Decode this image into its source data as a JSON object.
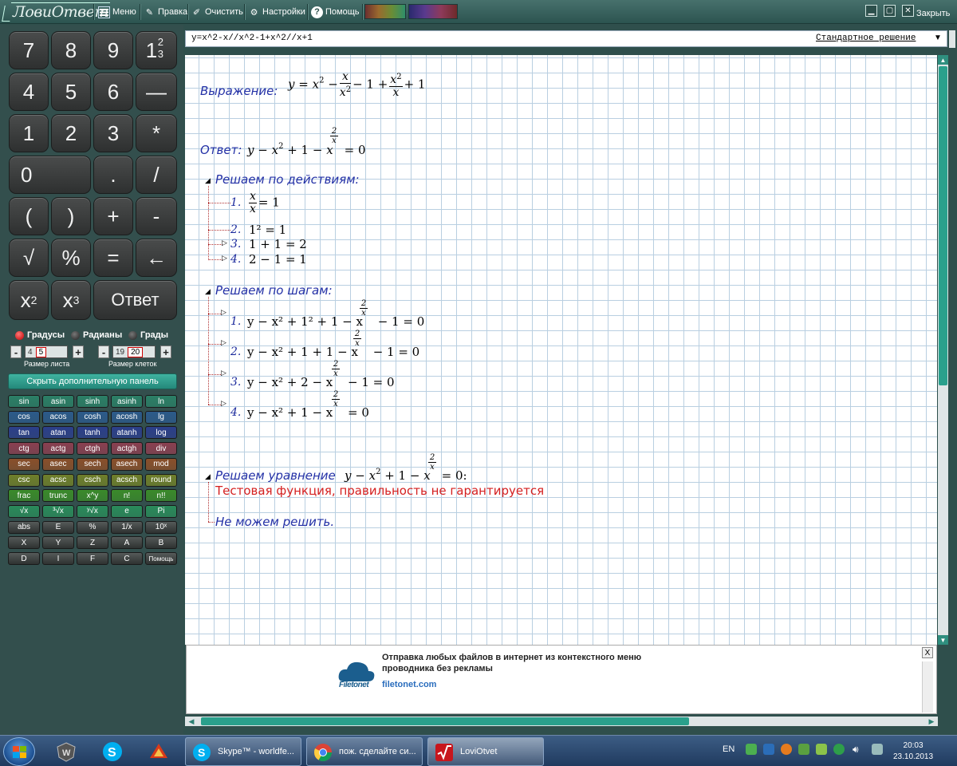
{
  "app": {
    "title": "ЛовиОтвет"
  },
  "toolbar": {
    "menu": "Меню",
    "edit": "Правка",
    "clear": "Очистить",
    "settings": "Настройки",
    "help": "Помощь",
    "close": "Закрыть"
  },
  "keypad": {
    "rows": [
      [
        "7",
        "8",
        "9",
        "1"
      ],
      [
        "4",
        "5",
        "6",
        "—"
      ],
      [
        "1",
        "2",
        "3",
        "*"
      ],
      [
        "0",
        ".",
        "/"
      ],
      [
        "(",
        ")",
        "+",
        "-"
      ],
      [
        "√",
        "%",
        "=",
        "←"
      ],
      [
        "x",
        "x",
        "Ответ"
      ]
    ],
    "frac_num": "2",
    "frac_den": "3",
    "sq": "2",
    "cube": "3"
  },
  "angle_units": {
    "degrees": "Градусы",
    "radians": "Радианы",
    "grads": "Грады",
    "selected": "degrees"
  },
  "sheet_size": {
    "label": "Размер листа",
    "prev": "4",
    "current": "5"
  },
  "cell_size": {
    "label": "Размер клеток",
    "prev": "19",
    "current": "20"
  },
  "extra_panel_button": "Скрыть дополнительную панель",
  "functions": [
    [
      "sin",
      "asin",
      "sinh",
      "asinh",
      "ln"
    ],
    [
      "cos",
      "acos",
      "cosh",
      "acosh",
      "lg"
    ],
    [
      "tan",
      "atan",
      "tanh",
      "atanh",
      "log"
    ],
    [
      "ctg",
      "actg",
      "ctgh",
      "actgh",
      "div"
    ],
    [
      "sec",
      "asec",
      "sech",
      "asech",
      "mod"
    ],
    [
      "csc",
      "acsc",
      "csch",
      "acsch",
      "round"
    ],
    [
      "frac",
      "trunc",
      "x^y",
      "n!",
      "n!!"
    ],
    [
      "√x",
      "³√x",
      "ʸ√x",
      "e",
      "Pi"
    ],
    [
      "abs",
      "E",
      "%",
      "1/x",
      "10ˣ"
    ],
    [
      "X",
      "Y",
      "Z",
      "A",
      "B"
    ],
    [
      "D",
      "I",
      "F",
      "C",
      "Помощь"
    ]
  ],
  "expression": {
    "input": "y=x^2-x//x^2-1+x^2//x+1",
    "mode": "Стандартное решение"
  },
  "solution": {
    "expr_label": "Выражение:",
    "answer_label": "Ответ:",
    "actions_header": "Решаем по действиям:",
    "actions": [
      {
        "n": "1.",
        "text": "= 1"
      },
      {
        "n": "2.",
        "text": "1² = 1"
      },
      {
        "n": "3.",
        "text": "1 + 1 = 2"
      },
      {
        "n": "4.",
        "text": "2 − 1 = 1"
      }
    ],
    "steps_header": "Решаем по шагам:",
    "steps": [
      {
        "n": "1.",
        "text": "y − x² + 1² + 1 − x",
        "tail": " − 1 = 0"
      },
      {
        "n": "2.",
        "text": "y − x² + 1 + 1 − x",
        "tail": " − 1 = 0"
      },
      {
        "n": "3.",
        "text": "y − x² + 2 − x",
        "tail": " − 1 = 0"
      },
      {
        "n": "4.",
        "text": "y − x² + 1 − x",
        "tail": " = 0"
      }
    ],
    "equation_header": "Решаем уравнение",
    "warning": "Тестовая функция, правильность не гарантируется",
    "cannot_solve": "Не можем решить."
  },
  "ad": {
    "title": "Отправка любых файлов в интернет из контекстного меню проводника без рекламы",
    "url": "filetonet.com",
    "brand": "Filetonet"
  },
  "taskbar": {
    "tasks": [
      "Skype™ - worldfe...",
      "пож. сделайте си...",
      "LoviOtvet"
    ],
    "lang": "EN",
    "time": "20:03",
    "date": "23.10.2013"
  }
}
